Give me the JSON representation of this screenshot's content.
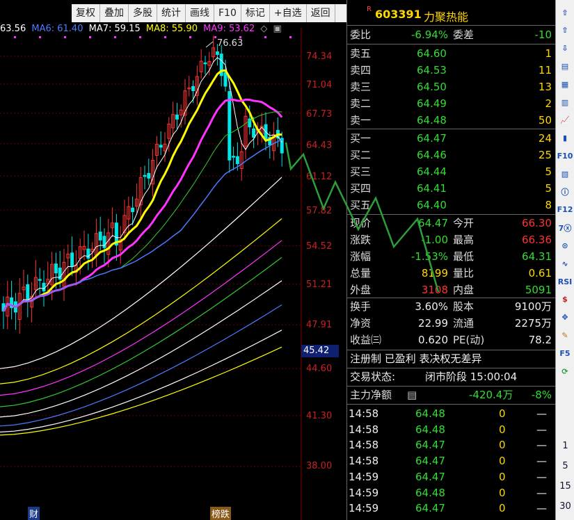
{
  "toolbar": {
    "items": [
      "复权",
      "叠加",
      "多股",
      "统计",
      "画线",
      "F10",
      "标记",
      "+自选",
      "返回"
    ]
  },
  "ma_legend": {
    "cut_value": "63.56",
    "ma6": "MA6: 61.40",
    "ma7": "MA7: 59.15",
    "ma8": "MA8: 55.90",
    "ma9": "MA9: 53.62"
  },
  "chart": {
    "high_label": "76.63",
    "price_labels": [
      "74.34",
      "71.04",
      "67.73",
      "64.43",
      "61.12",
      "57.82",
      "54.52",
      "51.21",
      "47.91",
      "44.60",
      "41.30",
      "38.00"
    ],
    "current_price": "45.42",
    "bottom_labels": [
      "财",
      "榜跌"
    ],
    "colors": {
      "up": "#ff3333",
      "down": "#00e5e5",
      "ma5": "#ffffff",
      "ma6": "#ffff00",
      "ma7": "#ff33ff",
      "ma8": "#33cc33",
      "ma9": "#4d7bff",
      "grid": "#6a0000",
      "drawing": "#2e9e3a"
    }
  },
  "header": {
    "badge": "R",
    "code": "603391",
    "name": "力聚热能"
  },
  "weibi": {
    "label1": "委比",
    "value1": "-6.94%",
    "label2": "委差",
    "value2": "-10"
  },
  "sell": [
    {
      "label": "卖五",
      "price": "64.60",
      "vol": "1"
    },
    {
      "label": "卖四",
      "price": "64.53",
      "vol": "11"
    },
    {
      "label": "卖三",
      "price": "64.50",
      "vol": "13"
    },
    {
      "label": "卖二",
      "price": "64.49",
      "vol": "2"
    },
    {
      "label": "卖一",
      "price": "64.48",
      "vol": "50"
    }
  ],
  "buy": [
    {
      "label": "买一",
      "price": "64.47",
      "vol": "24"
    },
    {
      "label": "买二",
      "price": "64.46",
      "vol": "25"
    },
    {
      "label": "买三",
      "price": "64.44",
      "vol": "5"
    },
    {
      "label": "买四",
      "price": "64.41",
      "vol": "5"
    },
    {
      "label": "买五",
      "price": "64.40",
      "vol": "8"
    }
  ],
  "quote": [
    {
      "l1": "现价",
      "v1": "64.47",
      "l2": "今开",
      "v2": "66.30"
    },
    {
      "l1": "涨跌",
      "v1": "-1.00",
      "l2": "最高",
      "v2": "66.36"
    },
    {
      "l1": "涨幅",
      "v1": "-1.53%",
      "l2": "最低",
      "v2": "64.31"
    },
    {
      "l1": "总量",
      "v1": "8199",
      "l2": "量比",
      "v2": "0.61"
    },
    {
      "l1": "外盘",
      "v1": "3108",
      "l2": "内盘",
      "v2": "5091"
    }
  ],
  "fund": [
    {
      "l1": "换手",
      "v1": "3.60%",
      "l2": "股本",
      "v2": "9100万"
    },
    {
      "l1": "净资",
      "v1": "22.99",
      "l2": "流通",
      "v2": "2275万"
    },
    {
      "l1": "收益㈢",
      "v1": "0.620",
      "l2": "PE(动)",
      "v2": "78.2"
    }
  ],
  "tags": "注册制 已盈利 表决权无差异",
  "status": {
    "label": "交易状态:",
    "value": "闭市阶段 15:00:04"
  },
  "mainflow": {
    "label": "主力净额",
    "value": "-420.4万",
    "pct": "-8%"
  },
  "ticks": [
    {
      "t": "14:58",
      "p": "64.48",
      "v": "0",
      "f": "—"
    },
    {
      "t": "14:58",
      "p": "64.48",
      "v": "0",
      "f": "—"
    },
    {
      "t": "14:58",
      "p": "64.47",
      "v": "0",
      "f": "—"
    },
    {
      "t": "14:58",
      "p": "64.47",
      "v": "0",
      "f": "—"
    },
    {
      "t": "14:59",
      "p": "64.47",
      "v": "0",
      "f": "—"
    },
    {
      "t": "14:59",
      "p": "64.48",
      "v": "0",
      "f": "—"
    },
    {
      "t": "14:59",
      "p": "64.47",
      "v": "0",
      "f": "—"
    }
  ],
  "sidebar": {
    "icons": [
      "arrow-up-hollow-icon",
      "arrow-up-icon",
      "arrow-down-icon",
      "list-icon",
      "grid-icon",
      "table-icon",
      "line-chart-icon",
      "kline-icon",
      "f10-icon",
      "news-icon",
      "info-icon",
      "f12-icon",
      "chat-icon",
      "settings-icon",
      "wave-icon",
      "rsi-icon",
      "dollar-icon",
      "move-icon",
      "pencil-icon",
      "f5-icon",
      "refresh-icon"
    ],
    "labels": {
      "f10": "F10",
      "f12": "F12",
      "rsi": "RSI",
      "f5": "F5"
    },
    "nums": [
      "1",
      "5",
      "15",
      "30"
    ]
  }
}
